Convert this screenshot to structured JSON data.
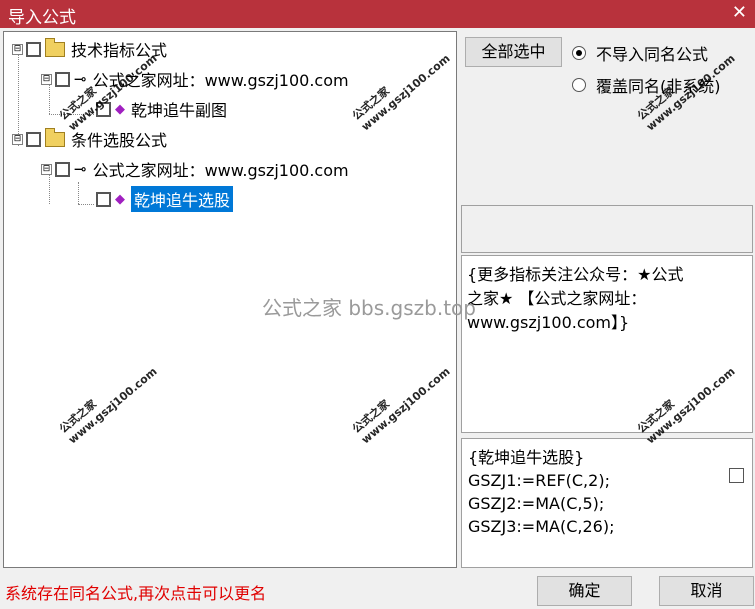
{
  "window": {
    "title": "导入公式",
    "close_glyph": "✕"
  },
  "tree": {
    "items": [
      {
        "label": "技术指标公式",
        "icon": "folder-icon",
        "expander": "⊟"
      },
      {
        "label": "公式之家网址：www.gszj100.com",
        "icon": "key-icon",
        "expander": "⊟"
      },
      {
        "label": "乾坤追牛副图",
        "icon": "formula-gem-icon"
      },
      {
        "label": "条件选股公式",
        "icon": "folder-icon",
        "expander": "⊟"
      },
      {
        "label": "公式之家网址：www.gszj100.com",
        "icon": "key-icon",
        "expander": "⊟"
      },
      {
        "label": "乾坤追牛选股",
        "icon": "formula-gem-icon",
        "selected": true
      }
    ]
  },
  "select_all_label": "全部选中",
  "options": {
    "no_import_same": "不导入同名公式",
    "overwrite_same": "覆盖同名(非系统)"
  },
  "description": {
    "line1": "{更多指标关注公众号：★公式",
    "line2": "之家★ 【公式之家网址：",
    "line3": "www.gszj100.com】}"
  },
  "code": {
    "line1": "{乾坤追牛选股}",
    "line2": "GSZJ1:=REF(C,2);",
    "line3": "GSZJ2:=MA(C,5);",
    "line4": "GSZJ3:=MA(C,26);"
  },
  "status_text": "系统存在同名公式,再次点击可以更名",
  "buttons": {
    "ok": "确定",
    "cancel": "取消"
  },
  "watermark": "公式之家 bbs.gszb.top",
  "stamp": {
    "cn": "公式之家",
    "url": "www.gszj100.com"
  },
  "colors": {
    "titlebar": "#b8323c",
    "selection": "#0078d7",
    "status": "#e00000"
  }
}
